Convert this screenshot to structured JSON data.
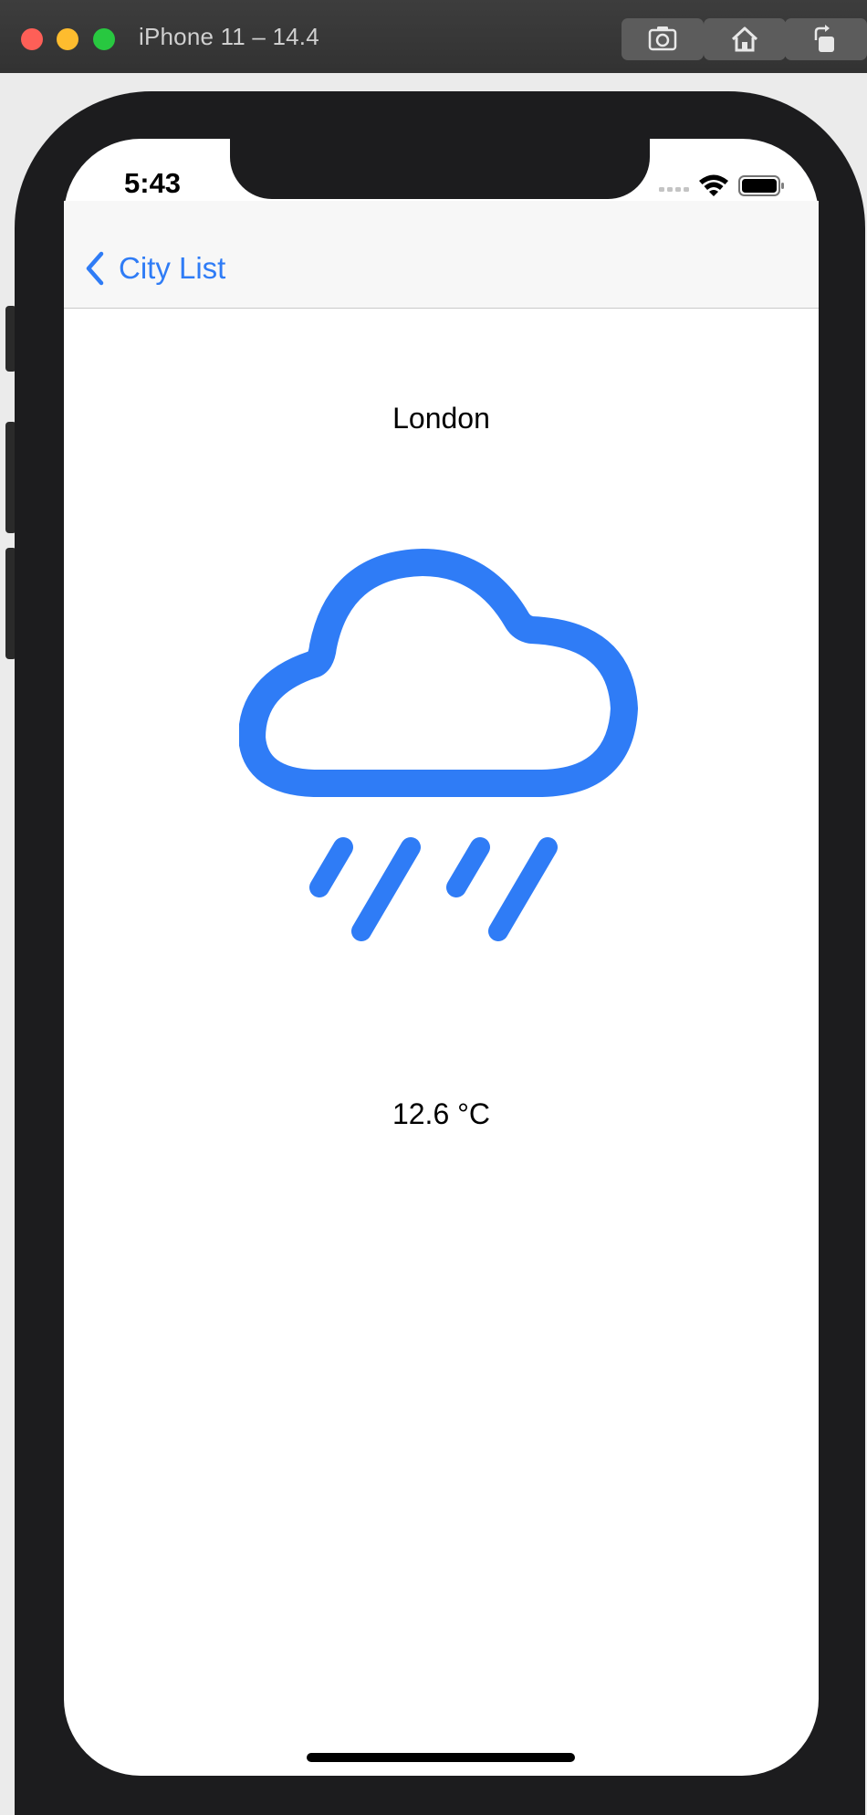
{
  "window": {
    "title": "iPhone 11 – 14.4"
  },
  "toolbar": {
    "screenshot_icon": "camera-icon",
    "home_icon": "home-icon",
    "rotate_icon": "rotate-icon"
  },
  "status_bar": {
    "time": "5:43",
    "signal_icon": "signal-dots-icon",
    "wifi_icon": "wifi-icon",
    "battery_icon": "battery-icon"
  },
  "nav": {
    "back_label": "City List",
    "back_icon": "chevron-left-icon"
  },
  "weather": {
    "city": "London",
    "icon": "cloud-rain-icon",
    "temperature": "12.6 °C"
  },
  "colors": {
    "accent": "#2f7cf6",
    "device": "#1c1c1e",
    "titlebar": "#383838"
  }
}
